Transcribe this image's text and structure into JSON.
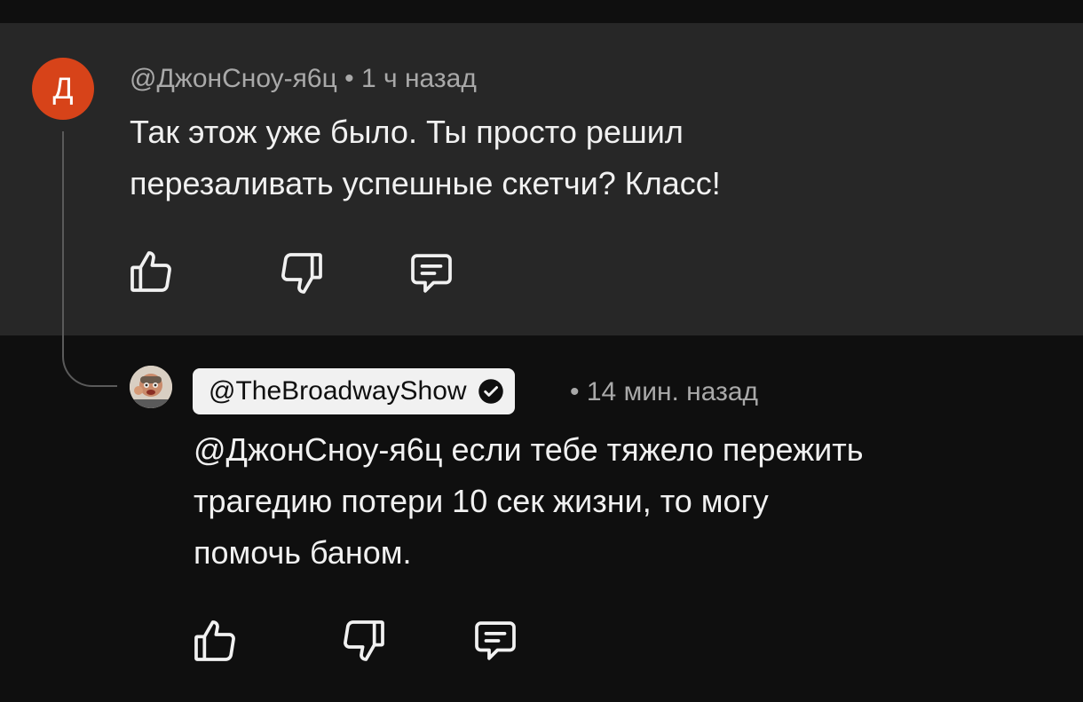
{
  "parent_comment": {
    "avatar_letter": "Д",
    "avatar_color": "#d74319",
    "author": "@ДжонСноу-я6ц",
    "separator": "•",
    "time": "1 ч назад",
    "text": "Так этож уже было. Ты просто решил\nперезаливать успешные скетчи? Класс!",
    "actions": {
      "like_icon": "thumbs-up-icon",
      "dislike_icon": "thumbs-down-icon",
      "reply_icon": "comment-icon"
    }
  },
  "reply_comment": {
    "author": "@TheBroadwayShow",
    "verified_icon": "verified-check-icon",
    "separator": "•",
    "time": "14 мин. назад",
    "text": "@ДжонСноу-я6ц если тебе тяжело пережить\nтрагедию потери 10 сек жизни, то могу\nпомочь баном.",
    "actions": {
      "like_icon": "thumbs-up-icon",
      "dislike_icon": "thumbs-down-icon",
      "reply_icon": "comment-icon"
    }
  },
  "colors": {
    "background": "#0f0f0f",
    "parent_highlight": "#272727",
    "text_primary": "#f1f1f1",
    "text_secondary": "#a9a9a9"
  }
}
